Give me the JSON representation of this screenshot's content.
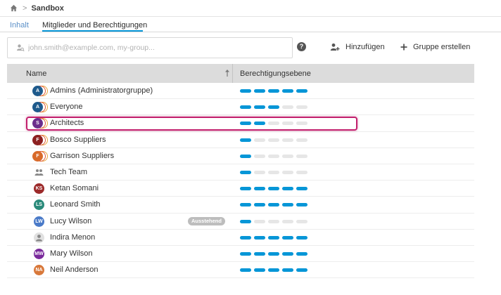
{
  "breadcrumb": {
    "home_icon": "home-icon",
    "separator": ">",
    "title": "Sandbox"
  },
  "tabs": [
    {
      "label": "Inhalt",
      "active": false
    },
    {
      "label": "Mitglieder und Berechtigungen",
      "active": true
    }
  ],
  "search": {
    "placeholder": "john.smith@example.com, my-group...",
    "value": "",
    "icon": "user-search-icon"
  },
  "toolbar": {
    "help_icon": "help-icon",
    "help_glyph": "?",
    "add_label": "Hinzufügen",
    "create_group_label": "Gruppe erstellen"
  },
  "table": {
    "col_name": "Name",
    "col_permission": "Berechtigungsebene",
    "sort": "ascending",
    "permission_max": 5,
    "rows": [
      {
        "name": "Admins (Administratorgruppe)",
        "type": "group",
        "initials": "A",
        "color": "#1e5a8c",
        "level": 5,
        "badge": ""
      },
      {
        "name": "Everyone",
        "type": "group",
        "initials": "A",
        "color": "#1e5a8c",
        "level": 3,
        "badge": ""
      },
      {
        "name": "Architects",
        "type": "group",
        "initials": "S",
        "color": "#6b2d8c",
        "level": 2,
        "badge": ""
      },
      {
        "name": "Bosco Suppliers",
        "type": "group",
        "initials": "F",
        "color": "#8c2020",
        "level": 1,
        "badge": ""
      },
      {
        "name": "Garrison Suppliers",
        "type": "group",
        "initials": "F",
        "color": "#d86a2a",
        "level": 1,
        "badge": ""
      },
      {
        "name": "Tech Team",
        "type": "team",
        "initials": "",
        "color": "#8a8a8a",
        "level": 1,
        "badge": ""
      },
      {
        "name": "Ketan Somani",
        "type": "user",
        "initials": "KS",
        "color": "#9c2a2a",
        "level": 5,
        "badge": ""
      },
      {
        "name": "Leonard Smith",
        "type": "user",
        "initials": "LS",
        "color": "#2a8a7a",
        "level": 5,
        "badge": ""
      },
      {
        "name": "Lucy Wilson",
        "type": "user",
        "initials": "LW",
        "color": "#4a7ac8",
        "level": 1,
        "badge": "Ausstehend"
      },
      {
        "name": "Indira Menon",
        "type": "placeholder",
        "initials": "",
        "color": "#e1e1e1",
        "level": 5,
        "badge": ""
      },
      {
        "name": "Mary Wilson",
        "type": "user",
        "initials": "MW",
        "color": "#7a2a9c",
        "level": 5,
        "badge": ""
      },
      {
        "name": "Neil Anderson",
        "type": "user",
        "initials": "NA",
        "color": "#d8783a",
        "level": 5,
        "badge": ""
      }
    ]
  },
  "highlight": {
    "row": "Architects",
    "color": "#c2206d"
  },
  "colors": {
    "accent": "#0696d7",
    "segment_off": "#e6e6e6"
  }
}
